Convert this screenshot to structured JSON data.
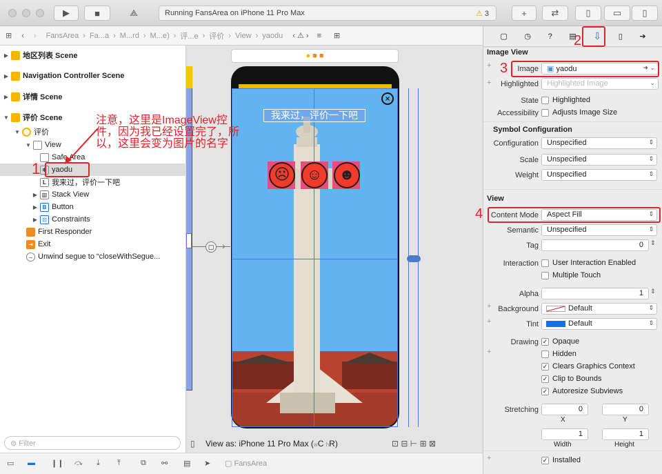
{
  "toolbar": {
    "status": "Running FansArea on iPhone 11 Pro Max",
    "warnings": "3"
  },
  "jumpbar": {
    "items": [
      "FansArea",
      "Fa...a",
      "M...rd",
      "M...e)",
      "评...e",
      "评价",
      "View",
      "yaodu"
    ]
  },
  "navigator": {
    "scenes": [
      {
        "label": "地区列表 Scene"
      },
      {
        "label": "Navigation Controller Scene"
      },
      {
        "label": "详情 Scene"
      },
      {
        "label": "评价 Scene"
      }
    ],
    "tree": [
      {
        "label": "评价",
        "icon": "view-controller-icon"
      },
      {
        "label": "View",
        "icon": "view-icon"
      },
      {
        "label": "Safe Area",
        "icon": "safe-area-icon"
      },
      {
        "label": "yaodu",
        "icon": "image-view-icon"
      },
      {
        "label": "我来过，评价一下吧",
        "icon": "label-icon",
        "badge": "L"
      },
      {
        "label": "Stack View",
        "icon": "stack-view-icon"
      },
      {
        "label": "Button",
        "icon": "button-icon",
        "badge": "B"
      },
      {
        "label": "Constraints",
        "icon": "constraints-icon"
      },
      {
        "label": "First Responder",
        "icon": "first-responder-icon"
      },
      {
        "label": "Exit",
        "icon": "exit-icon"
      },
      {
        "label": "Unwind segue to “closeWithSegue...",
        "icon": "unwind-segue-icon"
      }
    ],
    "filter_placeholder": "Filter"
  },
  "annotations": {
    "note": "注意，这里是ImageView控件，因为我已经设置完了，所以，这里会变为图片的名字",
    "n1": "1",
    "n2": "2",
    "n3": "3",
    "n4": "4"
  },
  "canvas": {
    "title_label": "我来过，评价一下吧",
    "view_as": "View as: iPhone 11 Pro Max (",
    "view_as_w": "w",
    "view_as_c": "C",
    "view_as_h": "h",
    "view_as_r": "R)"
  },
  "inspector": {
    "image_view_section": "Image View",
    "image_label": "Image",
    "image_value": "yaodu",
    "highlighted_label": "Highlighted",
    "highlighted_placeholder": "Highlighted Image",
    "state_label": "State",
    "state_highlighted": "Highlighted",
    "accessibility_label": "Accessibility",
    "adjusts_size": "Adjusts Image Size",
    "symbol_section": "Symbol Configuration",
    "configuration_label": "Configuration",
    "configuration_value": "Unspecified",
    "scale_label": "Scale",
    "scale_value": "Unspecified",
    "weight_label": "Weight",
    "weight_value": "Unspecified",
    "view_section": "View",
    "content_mode_label": "Content Mode",
    "content_mode_value": "Aspect Fill",
    "semantic_label": "Semantic",
    "semantic_value": "Unspecified",
    "tag_label": "Tag",
    "tag_value": "0",
    "interaction_label": "Interaction",
    "user_interaction": "User Interaction Enabled",
    "multiple_touch": "Multiple Touch",
    "alpha_label": "Alpha",
    "alpha_value": "1",
    "background_label": "Background",
    "background_value": "Default",
    "tint_label": "Tint",
    "tint_value": "Default",
    "drawing_label": "Drawing",
    "opaque": "Opaque",
    "hidden": "Hidden",
    "clears_graphics": "Clears Graphics Context",
    "clip_bounds": "Clip to Bounds",
    "autoresize": "Autoresize Subviews",
    "stretching_label": "Stretching",
    "stretch_x": "0",
    "stretch_y": "0",
    "x_label": "X",
    "y_label": "Y",
    "stretch_w": "1",
    "stretch_h": "1",
    "width_label": "Width",
    "height_label": "Height",
    "installed": "Installed"
  },
  "bottom": {
    "scheme": "FansArea"
  },
  "colors": {
    "accent": "#e0242a",
    "selection": "#dcdcdc",
    "canvas_bg": "#62b4f0"
  }
}
